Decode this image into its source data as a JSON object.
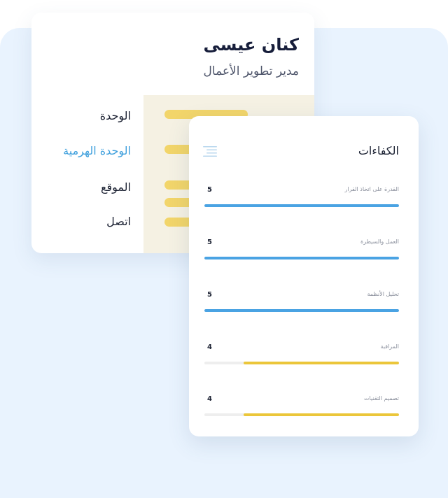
{
  "profile": {
    "name": "كنان عيسى",
    "role": "مدير تطوير الأعمال",
    "fields": [
      {
        "label": "الوحدة"
      },
      {
        "label": "الوحدة الهرمية"
      },
      {
        "label": "الموقع"
      },
      {
        "label": "اتصل"
      }
    ]
  },
  "competencies": {
    "title": "الكفاءات",
    "max_score": 5,
    "items": [
      {
        "label": "القدرة على اتخاذ القرار",
        "score": "5",
        "level": 1.0,
        "color": "#4aa3e3"
      },
      {
        "label": "العمل والسيطرة",
        "score": "5",
        "level": 1.0,
        "color": "#4aa3e3"
      },
      {
        "label": "تحليل الأنظمة",
        "score": "5",
        "level": 1.0,
        "color": "#4aa3e3"
      },
      {
        "label": "المراقبة",
        "score": "4",
        "level": 0.8,
        "color": "#ebc63a"
      },
      {
        "label": "تصميم التقنيات",
        "score": "4",
        "level": 0.8,
        "color": "#ebc63a"
      }
    ]
  },
  "colors": {
    "background": "#e9f3fe",
    "accent_blue": "#3fa0dd",
    "bar_yellow": "#f2d56a",
    "beige_panel": "#f5f1e3"
  },
  "icons": {
    "menu": "menu-icon"
  }
}
